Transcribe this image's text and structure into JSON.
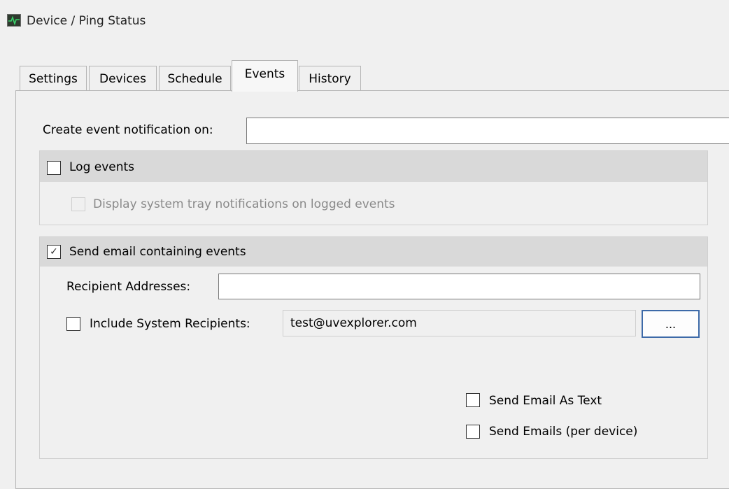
{
  "window": {
    "title": "Device / Ping Status",
    "icon": "pulse-monitor-icon"
  },
  "tabs": [
    {
      "label": "Settings",
      "active": false
    },
    {
      "label": "Devices",
      "active": false
    },
    {
      "label": "Schedule",
      "active": false
    },
    {
      "label": "Events",
      "active": true
    },
    {
      "label": "History",
      "active": false
    }
  ],
  "events": {
    "create_label": "Create event notification on:",
    "create_value": "",
    "log_group": {
      "checkbox_label": "Log events",
      "checked": false,
      "tray_label": "Display system tray notifications on logged events",
      "tray_checked": false,
      "tray_enabled": false
    },
    "email_group": {
      "checkbox_label": "Send email containing events",
      "checked": true,
      "check_glyph": "✓",
      "recipient_label": "Recipient Addresses:",
      "recipient_value": "",
      "include_label": "Include System Recipients:",
      "include_checked": false,
      "system_recipients_value": "test@uvexplorer.com",
      "browse_button_label": "...",
      "send_as_text_label": "Send Email As Text",
      "send_as_text_checked": false,
      "per_device_label": "Send Emails (per device)",
      "per_device_checked": false
    }
  }
}
